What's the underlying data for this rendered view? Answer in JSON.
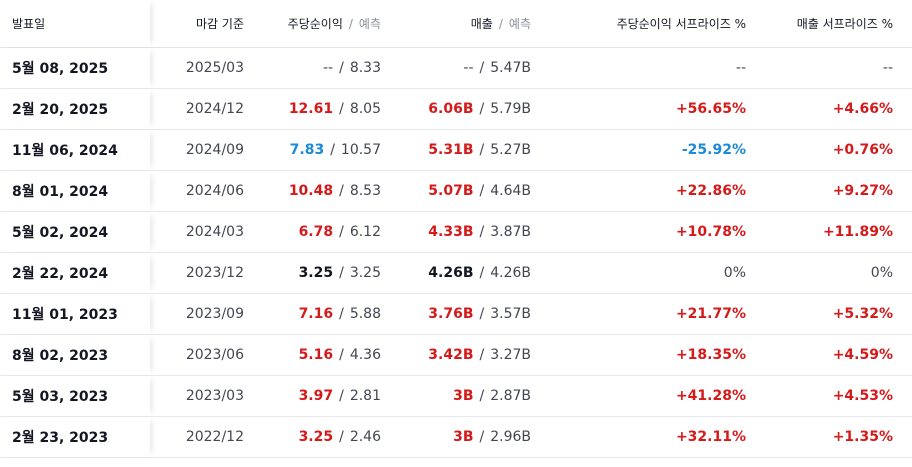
{
  "headers": {
    "date": "발표일",
    "period": "마감 기준",
    "eps": "주당순이익",
    "eps_forecast": "예측",
    "revenue": "매출",
    "revenue_forecast": "예측",
    "eps_surprise": "주당순이익 서프라이즈 %",
    "revenue_surprise": "매출 서프라이즈 %"
  },
  "separator": "/",
  "colors": {
    "positive": "#d51a1a",
    "negative": "#1c8ad8",
    "neutral": "#131722"
  },
  "rows": [
    {
      "date": "5월 08, 2025",
      "period": "2025/03",
      "eps": "--",
      "eps_dir": "none",
      "eps_forecast": "8.33",
      "revenue": "--",
      "rev_dir": "none",
      "revenue_forecast": "5.47B",
      "eps_surprise": "--",
      "eps_s_dir": "none",
      "revenue_surprise": "--",
      "rev_s_dir": "none"
    },
    {
      "date": "2월 20, 2025",
      "period": "2024/12",
      "eps": "12.61",
      "eps_dir": "pos",
      "eps_forecast": "8.05",
      "revenue": "6.06B",
      "rev_dir": "pos",
      "revenue_forecast": "5.79B",
      "eps_surprise": "+56.65%",
      "eps_s_dir": "pos",
      "revenue_surprise": "+4.66%",
      "rev_s_dir": "pos"
    },
    {
      "date": "11월 06, 2024",
      "period": "2024/09",
      "eps": "7.83",
      "eps_dir": "neg",
      "eps_forecast": "10.57",
      "revenue": "5.31B",
      "rev_dir": "pos",
      "revenue_forecast": "5.27B",
      "eps_surprise": "-25.92%",
      "eps_s_dir": "neg",
      "revenue_surprise": "+0.76%",
      "rev_s_dir": "pos"
    },
    {
      "date": "8월 01, 2024",
      "period": "2024/06",
      "eps": "10.48",
      "eps_dir": "pos",
      "eps_forecast": "8.53",
      "revenue": "5.07B",
      "rev_dir": "pos",
      "revenue_forecast": "4.64B",
      "eps_surprise": "+22.86%",
      "eps_s_dir": "pos",
      "revenue_surprise": "+9.27%",
      "rev_s_dir": "pos"
    },
    {
      "date": "5월 02, 2024",
      "period": "2024/03",
      "eps": "6.78",
      "eps_dir": "pos",
      "eps_forecast": "6.12",
      "revenue": "4.33B",
      "rev_dir": "pos",
      "revenue_forecast": "3.87B",
      "eps_surprise": "+10.78%",
      "eps_s_dir": "pos",
      "revenue_surprise": "+11.89%",
      "rev_s_dir": "pos"
    },
    {
      "date": "2월 22, 2024",
      "period": "2023/12",
      "eps": "3.25",
      "eps_dir": "neutral",
      "eps_forecast": "3.25",
      "revenue": "4.26B",
      "rev_dir": "neutral",
      "revenue_forecast": "4.26B",
      "eps_surprise": "0%",
      "eps_s_dir": "neutral",
      "revenue_surprise": "0%",
      "rev_s_dir": "neutral"
    },
    {
      "date": "11월 01, 2023",
      "period": "2023/09",
      "eps": "7.16",
      "eps_dir": "pos",
      "eps_forecast": "5.88",
      "revenue": "3.76B",
      "rev_dir": "pos",
      "revenue_forecast": "3.57B",
      "eps_surprise": "+21.77%",
      "eps_s_dir": "pos",
      "revenue_surprise": "+5.32%",
      "rev_s_dir": "pos"
    },
    {
      "date": "8월 02, 2023",
      "period": "2023/06",
      "eps": "5.16",
      "eps_dir": "pos",
      "eps_forecast": "4.36",
      "revenue": "3.42B",
      "rev_dir": "pos",
      "revenue_forecast": "3.27B",
      "eps_surprise": "+18.35%",
      "eps_s_dir": "pos",
      "revenue_surprise": "+4.59%",
      "rev_s_dir": "pos"
    },
    {
      "date": "5월 03, 2023",
      "period": "2023/03",
      "eps": "3.97",
      "eps_dir": "pos",
      "eps_forecast": "2.81",
      "revenue": "3B",
      "rev_dir": "pos",
      "revenue_forecast": "2.87B",
      "eps_surprise": "+41.28%",
      "eps_s_dir": "pos",
      "revenue_surprise": "+4.53%",
      "rev_s_dir": "pos"
    },
    {
      "date": "2월 23, 2023",
      "period": "2022/12",
      "eps": "3.25",
      "eps_dir": "pos",
      "eps_forecast": "2.46",
      "revenue": "3B",
      "rev_dir": "pos",
      "revenue_forecast": "2.96B",
      "eps_surprise": "+32.11%",
      "eps_s_dir": "pos",
      "revenue_surprise": "+1.35%",
      "rev_s_dir": "pos"
    }
  ]
}
